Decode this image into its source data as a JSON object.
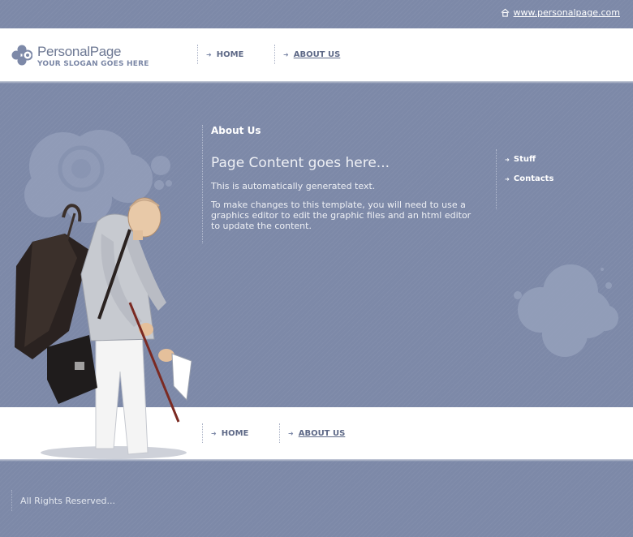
{
  "topbar": {
    "site_link": "www.personalpage.com",
    "icon": "home-icon"
  },
  "logo": {
    "title": "PersonalPage",
    "slogan": "YOUR SLOGAN GOES HERE",
    "icon": "clover-logo-icon"
  },
  "nav": {
    "items": [
      {
        "label": "HOME",
        "active": false
      },
      {
        "label": "ABOUT US",
        "active": true
      }
    ]
  },
  "content": {
    "section_title": "About Us",
    "heading": "Page Content goes here...",
    "paragraphs": [
      "This is automatically generated text.",
      "To make changes to this template, you will need to use a graphics editor to edit the graphic files and an html editor to update the content."
    ]
  },
  "side_links": [
    {
      "label": "Stuff"
    },
    {
      "label": "Contacts"
    }
  ],
  "footer_nav": {
    "items": [
      {
        "label": "HOME",
        "active": false
      },
      {
        "label": "ABOUT US",
        "active": true
      }
    ]
  },
  "copyright": "All Rights Reserved...",
  "colors": {
    "background": "#7d89a8",
    "band": "#ffffff",
    "nav_text": "#5e6987"
  }
}
